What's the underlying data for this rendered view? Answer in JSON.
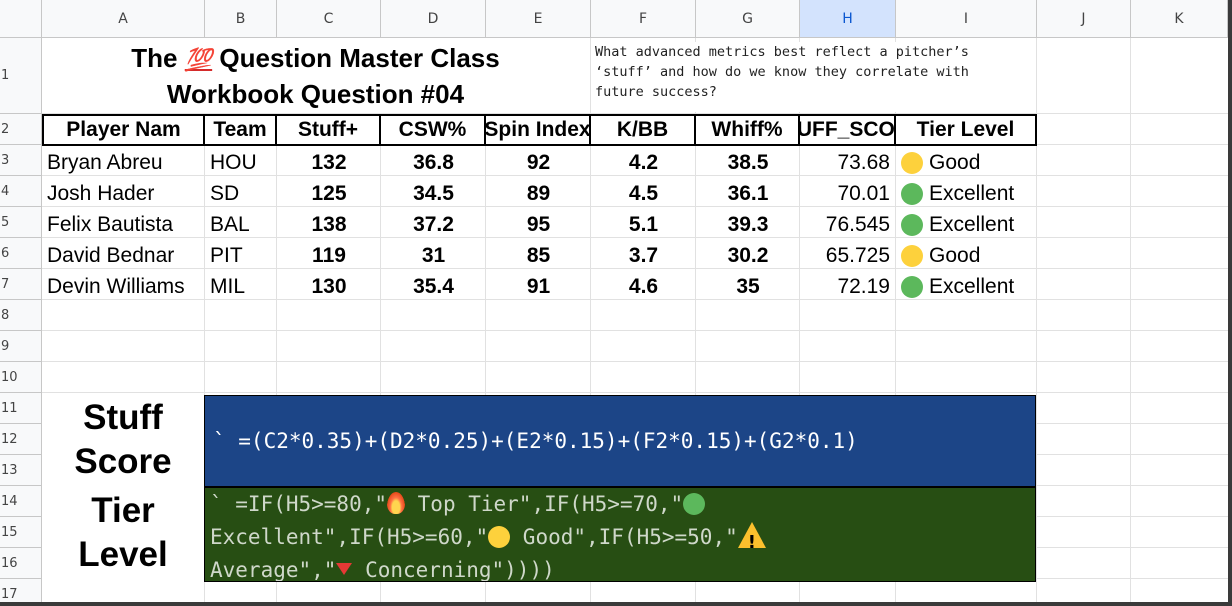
{
  "columns": [
    "A",
    "B",
    "C",
    "D",
    "E",
    "F",
    "G",
    "H",
    "I",
    "J",
    "K"
  ],
  "selected_column": "H",
  "rows": [
    "1",
    "2",
    "3",
    "4",
    "5",
    "6",
    "7",
    "8",
    "9",
    "10",
    "11",
    "12",
    "13",
    "14",
    "15",
    "16",
    "17"
  ],
  "title": {
    "line1_pre": "The ",
    "line1_emoji": "💯",
    "line1_post": " Question Master Class",
    "line2": "Workbook Question #04"
  },
  "question_text": {
    "line1": "What advanced metrics best reflect a pitcher’s",
    "line2": "‘stuff’ and how do we know they correlate with",
    "line3": "future success?"
  },
  "table": {
    "headers": [
      "Player Nam",
      "Team",
      "Stuff+",
      "CSW%",
      "Spin Index",
      "K/BB",
      "Whiff%",
      "STUFF_SCORE",
      "Tier Level"
    ],
    "rows": [
      {
        "player": "Bryan Abreu",
        "team": "HOU",
        "stuff": "132",
        "csw": "36.8",
        "spin": "92",
        "kbb": "4.2",
        "whiff": "38.5",
        "score": "73.68",
        "tier": "Good",
        "tier_color": "#fdd13c"
      },
      {
        "player": "Josh Hader",
        "team": "SD",
        "stuff": "125",
        "csw": "34.5",
        "spin": "89",
        "kbb": "4.5",
        "whiff": "36.1",
        "score": "70.01",
        "tier": "Excellent",
        "tier_color": "#5cb85c"
      },
      {
        "player": "Felix Bautista",
        "team": "BAL",
        "stuff": "138",
        "csw": "37.2",
        "spin": "95",
        "kbb": "5.1",
        "whiff": "39.3",
        "score": "76.545",
        "tier": "Excellent",
        "tier_color": "#5cb85c"
      },
      {
        "player": "David Bednar",
        "team": "PIT",
        "stuff": "119",
        "csw": "31",
        "spin": "85",
        "kbb": "3.7",
        "whiff": "30.2",
        "score": "65.725",
        "tier": "Good",
        "tier_color": "#fdd13c"
      },
      {
        "player": "Devin Williams",
        "team": "MIL",
        "stuff": "130",
        "csw": "35.4",
        "spin": "91",
        "kbb": "4.6",
        "whiff": "35",
        "score": "72.19",
        "tier": "Excellent",
        "tier_color": "#5cb85c"
      }
    ]
  },
  "stuff_label": {
    "line1": "Stuff",
    "line2": "Score"
  },
  "tier_label": {
    "line1": "Tier",
    "line2": "Level"
  },
  "stuff_formula": "` =(C2*0.35)+(D2*0.25)+(E2*0.15)+(F2*0.15)+(G2*0.1)",
  "tier_formula": {
    "line1_pre": "` =IF(H5>=80,\"",
    "line1_mid": " Top Tier\",IF(H5>=70,\"",
    "line2_a": "Excellent\",IF(H5>=60,\"",
    "line2_b": " Good\",IF(H5>=50,\"",
    "line3_a": "Average\",\"",
    "line3_b": " Concerning\"))))"
  },
  "colors": {
    "stuff_box_bg": "#1c4587",
    "tier_box_bg": "#274e13",
    "good_dot": "#fdd13c",
    "excellent_dot": "#5cb85c",
    "selected_column_bg": "#d3e3fd"
  }
}
